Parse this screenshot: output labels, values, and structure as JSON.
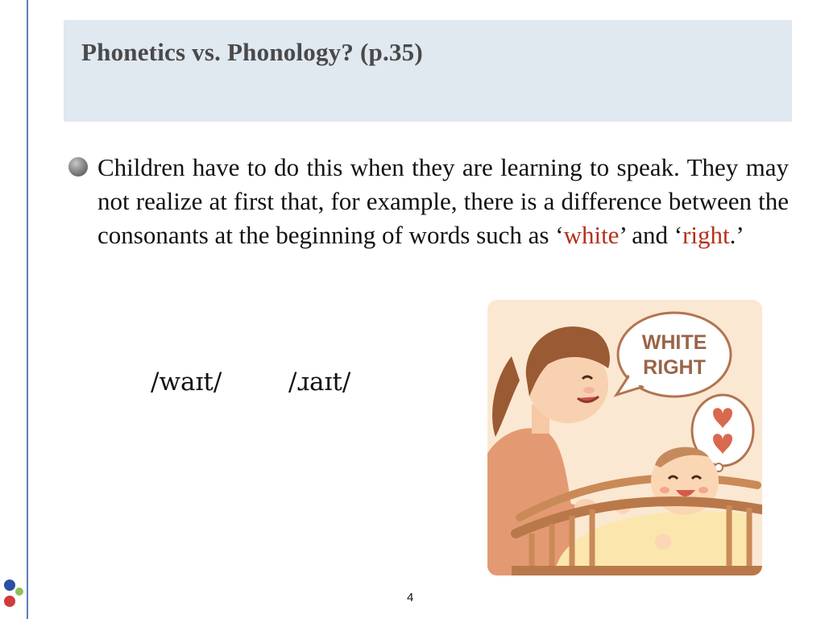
{
  "slide": {
    "title": "Phonetics vs. Phonology? (p.35)",
    "body": {
      "text_before": "Children have to do this when they are learning to speak. They may not realize at first that, for example, there is a difference between the consonants at the beginning of words such as ‘",
      "word1": "white",
      "text_between": "’ and ‘",
      "word2": "right",
      "text_after": ".’"
    },
    "ipa": [
      "/waɪt/",
      "/ɹaɪt/"
    ],
    "speech_bubble": [
      "WHITE",
      "RIGHT"
    ],
    "page_number": "4"
  },
  "colors": {
    "title_bg": "#e0e8f0",
    "highlight": "#b5301c",
    "left_rule": "#5b7fb8"
  }
}
